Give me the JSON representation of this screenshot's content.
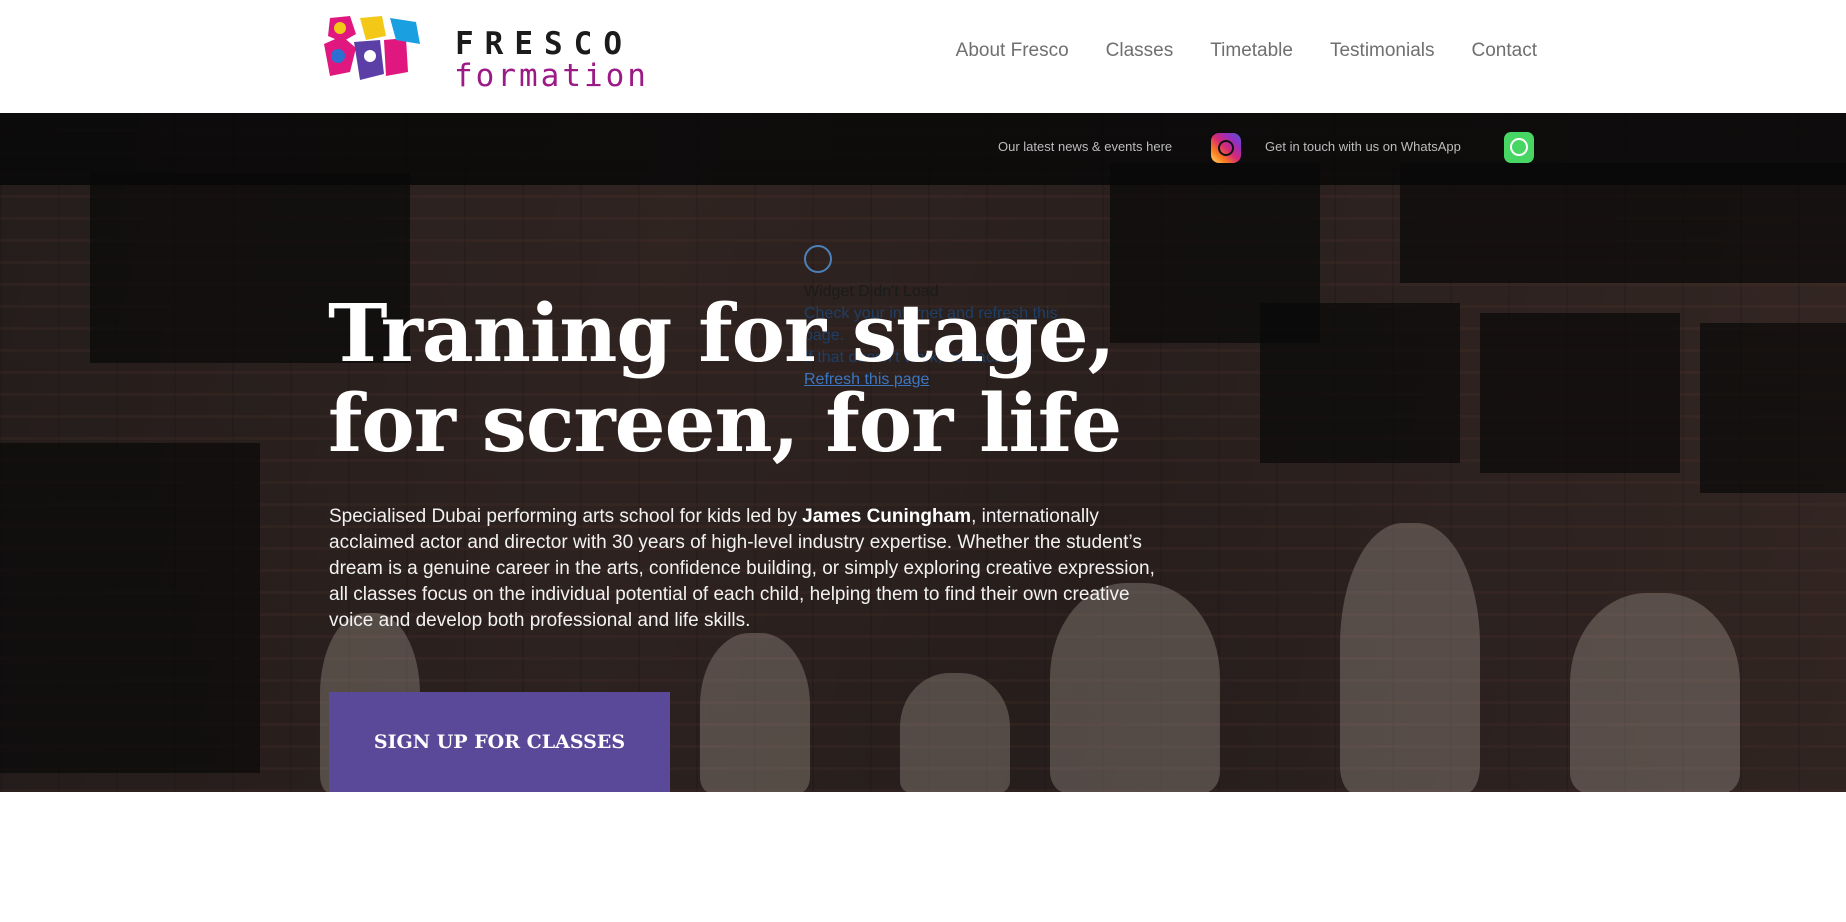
{
  "header": {
    "logo_word1": "FRESCO",
    "logo_word2": "formation",
    "nav": [
      "About Fresco",
      "Classes",
      "Timetable",
      "Testimonials",
      "Contact"
    ]
  },
  "social_bar": {
    "news_text": "Our latest news & events here",
    "whatsapp_text": "Get in touch with us on WhatsApp",
    "icons": [
      "instagram-icon",
      "whatsapp-icon"
    ]
  },
  "widget_error": {
    "title": "Widget Didn't Load",
    "line2": "Check your internet and refresh this page.",
    "line3": "If that doesn't work, contact us.",
    "link": "Refresh this page"
  },
  "hero": {
    "headline_line1": "Traning for stage,",
    "headline_line2": "for screen, for life",
    "intro_before": "Specialised Dubai performing arts school for kids led by ",
    "intro_name": "James Cuningham",
    "intro_after": ", internationally acclaimed actor and director with 30 years of high-level industry expertise. Whether the student’s dream is a genuine career in the arts, confidence building, or simply exploring creative expression, all classes focus on the individual potential of each child, helping them to find their own creative voice and develop both professional and life skills.",
    "cta": "SIGN UP FOR CLASSES"
  },
  "colors": {
    "accent": "#5a4999",
    "logo_magenta": "#9c1a86",
    "nav_text": "#6f6f6f"
  }
}
